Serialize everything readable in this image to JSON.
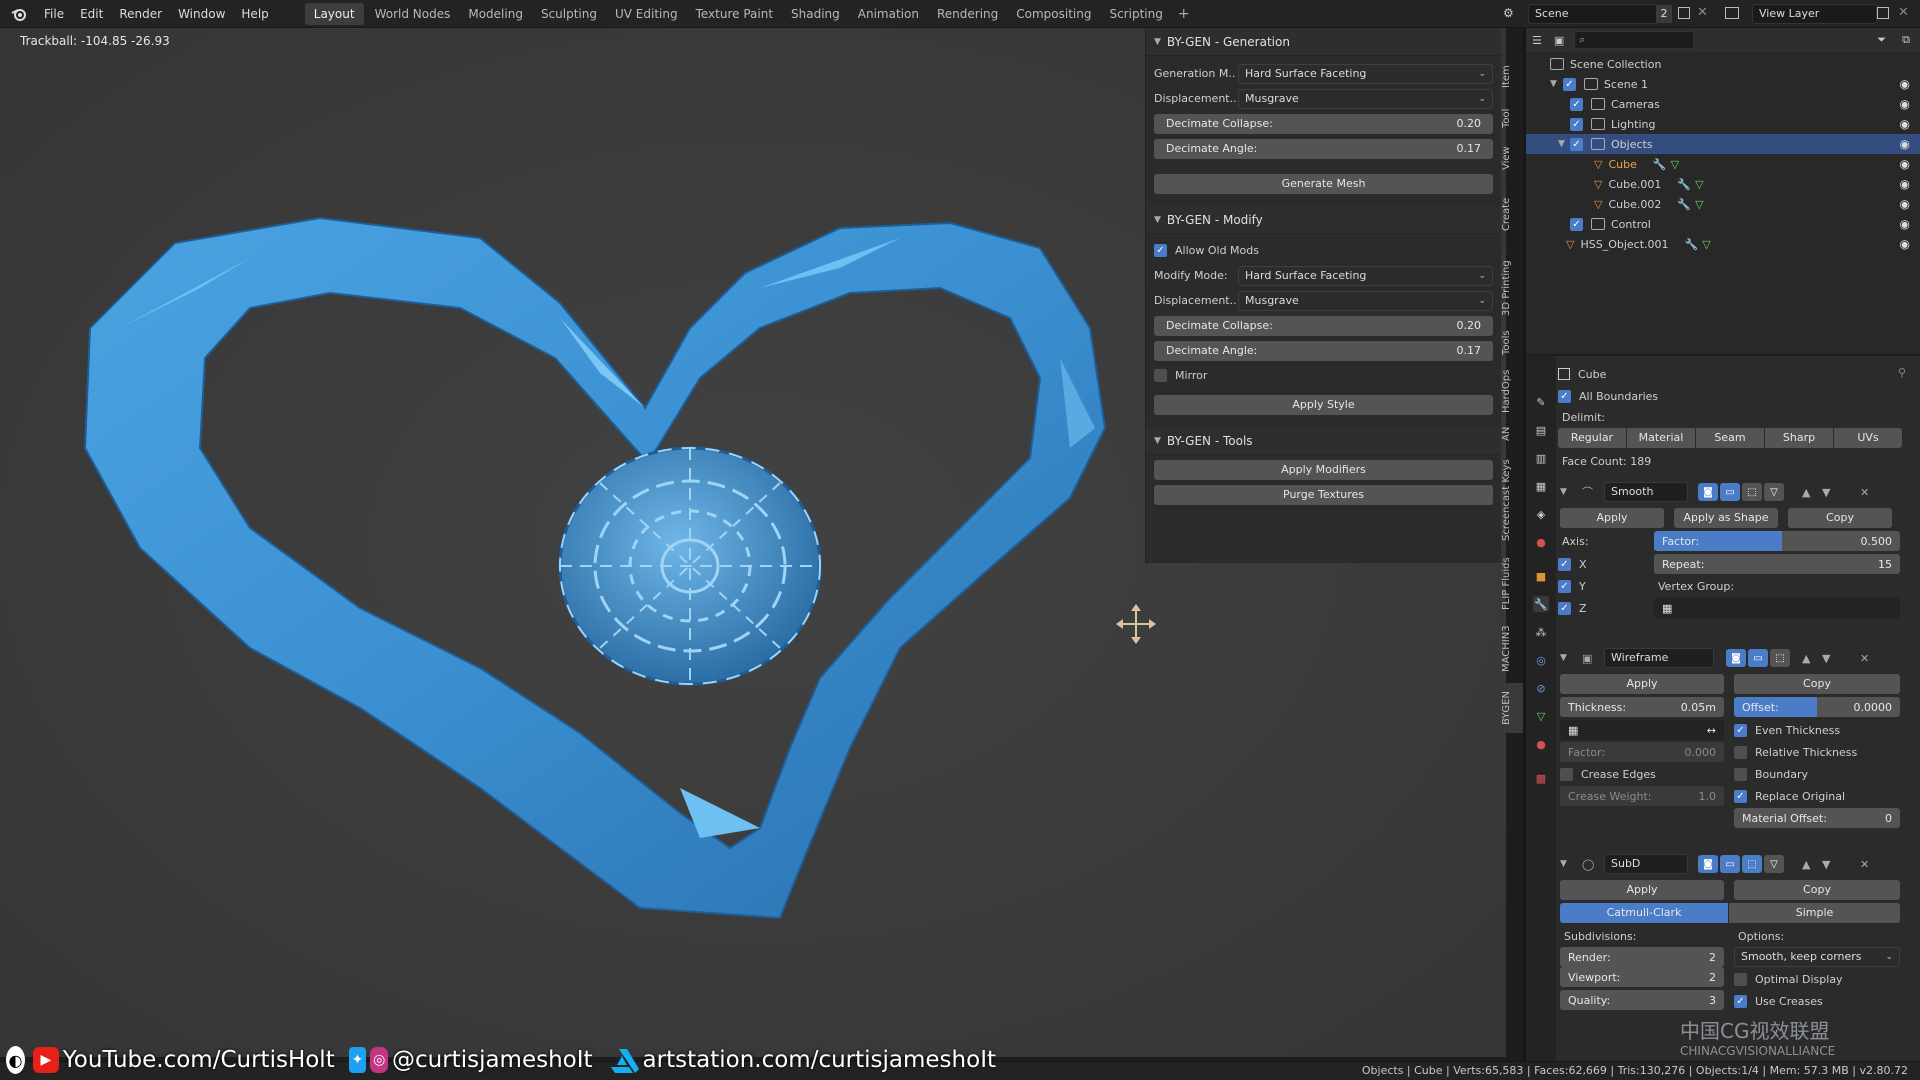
{
  "topbar": {
    "menus": [
      "File",
      "Edit",
      "Render",
      "Window",
      "Help"
    ],
    "workspaces": [
      "Layout",
      "World Nodes",
      "Modeling",
      "Sculpting",
      "UV Editing",
      "Texture Paint",
      "Shading",
      "Animation",
      "Rendering",
      "Compositing",
      "Scripting"
    ],
    "active_workspace": "Layout",
    "add_tab": "+",
    "scene_name": "Scene",
    "scene_users": "2",
    "view_layer": "View Layer"
  },
  "viewport": {
    "trackball": "Trackball: -104.85 -26.93",
    "object_color": "#3a90d0"
  },
  "npanel": {
    "generation": {
      "title": "BY-GEN - Generation",
      "gen_mode_label": "Generation M..",
      "gen_mode_value": "Hard Surface Faceting",
      "disp_label": "Displacement..",
      "disp_value": "Musgrave",
      "decimate_collapse_label": "Decimate Collapse:",
      "decimate_collapse_value": "0.20",
      "decimate_angle_label": "Decimate Angle:",
      "decimate_angle_value": "0.17",
      "generate_btn": "Generate Mesh"
    },
    "modify": {
      "title": "BY-GEN - Modify",
      "allow_old_mods": "Allow Old Mods",
      "mode_label": "Modify Mode:",
      "mode_value": "Hard Surface Faceting",
      "disp_label": "Displacement..",
      "disp_value": "Musgrave",
      "decimate_collapse_label": "Decimate Collapse:",
      "decimate_collapse_value": "0.20",
      "decimate_angle_label": "Decimate Angle:",
      "decimate_angle_value": "0.17",
      "mirror": "Mirror",
      "apply_style_btn": "Apply Style"
    },
    "tools": {
      "title": "BY-GEN - Tools",
      "apply_modifiers_btn": "Apply Modifiers",
      "purge_textures_btn": "Purge Textures"
    }
  },
  "vtabs": [
    "Item",
    "Tool",
    "View",
    "Create",
    "3D Printing",
    "Tools",
    "HardOps",
    "AN",
    "Screencast Keys",
    "FLIP Fluids",
    "MACHIN3",
    "BYGEN"
  ],
  "outliner": {
    "root": "Scene Collection",
    "rows": [
      {
        "label": "Scene 1",
        "selected": false,
        "checkbox": true
      },
      {
        "label": "Cameras",
        "selected": false,
        "checkbox": true
      },
      {
        "label": "Lighting",
        "selected": false,
        "checkbox": true
      },
      {
        "label": "Objects",
        "selected": true,
        "checkbox": true
      },
      {
        "label": "Cube",
        "selected": false,
        "checkbox": false
      },
      {
        "label": "Cube.001",
        "selected": false,
        "checkbox": false
      },
      {
        "label": "Cube.002",
        "selected": false,
        "checkbox": false
      },
      {
        "label": "Control",
        "selected": false,
        "checkbox": true
      },
      {
        "label": "HSS_Object.001",
        "selected": false,
        "checkbox": false
      }
    ]
  },
  "properties": {
    "object_name": "Cube",
    "all_boundaries": "All Boundaries",
    "delimit_label": "Delimit:",
    "delimit_options": [
      "Regular",
      "Material",
      "Seam",
      "Sharp",
      "UVs"
    ],
    "face_count": "Face Count: 189",
    "smooth": {
      "name": "Smooth",
      "apply": "Apply",
      "apply_shape": "Apply as Shape Key",
      "copy": "Copy",
      "axis_label": "Axis:",
      "factor_label": "Factor:",
      "factor_value": "0.500",
      "repeat_label": "Repeat:",
      "repeat_value": "15",
      "x": "X",
      "y": "Y",
      "z": "Z",
      "vertex_group": "Vertex Group:"
    },
    "wireframe": {
      "name": "Wireframe",
      "apply": "Apply",
      "copy": "Copy",
      "thickness_label": "Thickness:",
      "thickness_value": "0.05m",
      "offset_label": "Offset:",
      "offset_value": "0.0000",
      "even_thickness": "Even Thickness",
      "relative_thickness": "Relative Thickness",
      "factor_label": "Factor:",
      "factor_value": "0.000",
      "boundary": "Boundary",
      "crease_edges": "Crease Edges",
      "replace_original": "Replace Original",
      "crease_weight_label": "Crease Weight:",
      "crease_weight_value": "1.0",
      "material_offset_label": "Material Offset:",
      "material_offset_value": "0"
    },
    "subd": {
      "name": "SubD",
      "apply": "Apply",
      "copy": "Copy",
      "catmull": "Catmull-Clark",
      "simple": "Simple",
      "subdivisions_label": "Subdivisions:",
      "options_label": "Options:",
      "render_label": "Render:",
      "render_value": "2",
      "viewport_label": "Viewport:",
      "viewport_value": "2",
      "quality_label": "Quality:",
      "quality_value": "3",
      "uv_option": "Smooth, keep corners",
      "optimal_display": "Optimal Display",
      "use_creases": "Use Creases"
    }
  },
  "status": "Objects | Cube | Verts:65,583 | Faces:62,669 | Tris:130,276 | Objects:1/4 | Mem: 57.3 MB | v2.80.72",
  "overlay": {
    "youtube": "YouTube.com/CurtisHolt",
    "social": "@curtisjameshoIt",
    "artstation": "artstation.com/curtisjameshoIt"
  },
  "watermark": {
    "line1": "中国CG视效联盟",
    "line2": "CHINACGVISIONALLIANCE"
  }
}
